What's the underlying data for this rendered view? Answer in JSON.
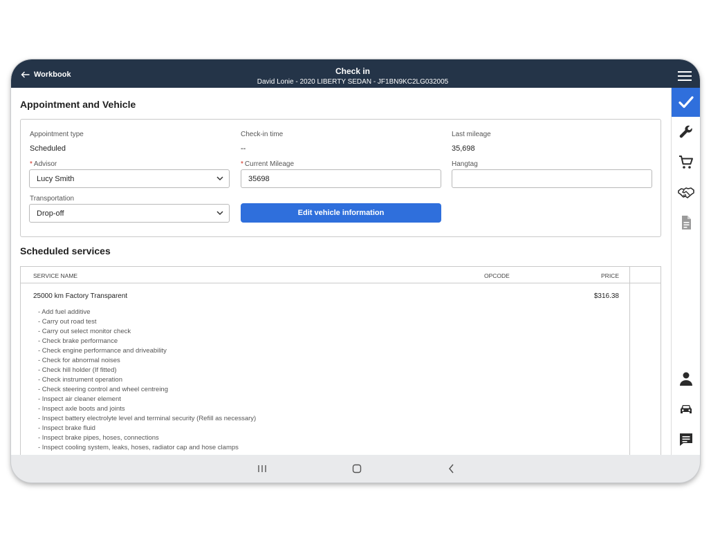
{
  "header": {
    "back_label": "Workbook",
    "title": "Check in",
    "subtitle": "David Lonie - 2020 LIBERTY SEDAN - JF1BN9KC2LG032005"
  },
  "appointment": {
    "heading": "Appointment and Vehicle",
    "appointment_type_label": "Appointment type",
    "appointment_type_value": "Scheduled",
    "checkin_time_label": "Check-in time",
    "checkin_time_value": "--",
    "last_mileage_label": "Last mileage",
    "last_mileage_value": "35,698",
    "advisor_label": "Advisor",
    "advisor_value": "Lucy Smith",
    "current_mileage_label": "Current Mileage",
    "current_mileage_value": "35698",
    "hangtag_label": "Hangtag",
    "hangtag_value": "",
    "transportation_label": "Transportation",
    "transportation_value": "Drop-off",
    "edit_vehicle_label": "Edit vehicle information",
    "required_mark": "*"
  },
  "services": {
    "heading": "Scheduled services",
    "columns": {
      "name": "SERVICE NAME",
      "opcode": "OPCODE",
      "price": "PRICE"
    },
    "items": [
      {
        "name": "25000 km Factory Transparent",
        "opcode": "",
        "price": "$316.38",
        "tasks": [
          "- Add fuel additive",
          "- Carry out road test",
          "- Carry out select monitor check",
          "- Check brake performance",
          "- Check engine performance and driveability",
          "- Check for abnormal noises",
          "- Check hill holder (If fitted)",
          "- Check instrument operation",
          "- Check steering control and wheel centreing",
          "- Inspect air cleaner element",
          "- Inspect axle boots and joints",
          "- Inspect battery electrolyte level and terminal security (Refill as necessary)",
          "- Inspect brake fluid",
          "- Inspect brake pipes, hoses, connections",
          "- Inspect cooling system, leaks, hoses, radiator cap and hose clamps"
        ]
      }
    ]
  },
  "rail": {
    "top_icons": [
      "check-icon",
      "wrench-icon",
      "cart-icon",
      "handshake-icon",
      "document-icon"
    ],
    "bottom_icons": [
      "person-icon",
      "car-icon",
      "chat-icon"
    ],
    "active_index": 0
  },
  "colors": {
    "header_bg": "#243448",
    "accent": "#2f6fdc",
    "required": "#d0291c"
  },
  "navbar_icons": [
    "recent-apps-icon",
    "home-icon",
    "back-nav-icon"
  ]
}
